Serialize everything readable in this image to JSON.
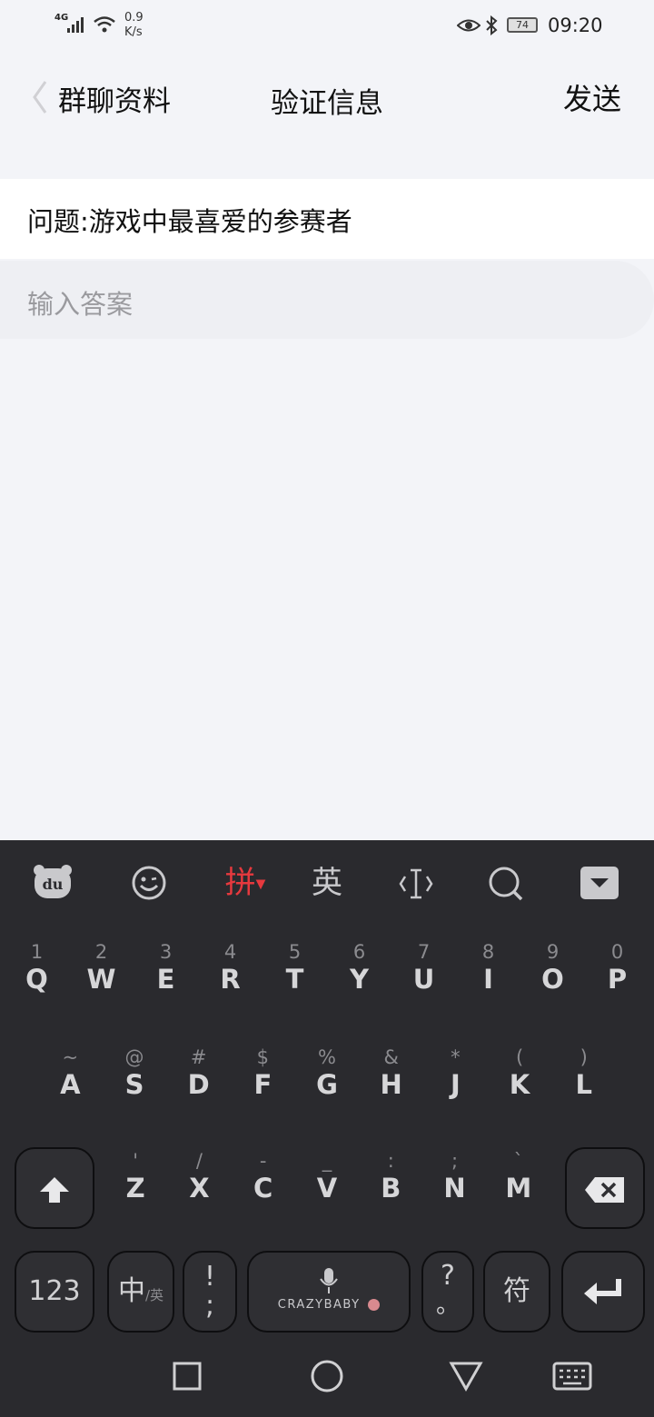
{
  "status_bar": {
    "network": "4G",
    "speed_value": "0.9",
    "speed_unit": "K/s",
    "battery": "74",
    "time": "09:20"
  },
  "header": {
    "back_label": "群聊资料",
    "title": "验证信息",
    "send": "发送"
  },
  "question": "问题:游戏中最喜爱的参赛者",
  "answer": {
    "placeholder": "输入答案"
  },
  "keyboard": {
    "toolbar": {
      "pinyin": "拼",
      "english": "英"
    },
    "row1": [
      {
        "sub": "1",
        "main": "Q"
      },
      {
        "sub": "2",
        "main": "W"
      },
      {
        "sub": "3",
        "main": "E"
      },
      {
        "sub": "4",
        "main": "R"
      },
      {
        "sub": "5",
        "main": "T"
      },
      {
        "sub": "6",
        "main": "Y"
      },
      {
        "sub": "7",
        "main": "U"
      },
      {
        "sub": "8",
        "main": "I"
      },
      {
        "sub": "9",
        "main": "O"
      },
      {
        "sub": "0",
        "main": "P"
      }
    ],
    "row2": [
      {
        "sub": "~",
        "main": "A"
      },
      {
        "sub": "@",
        "main": "S"
      },
      {
        "sub": "#",
        "main": "D"
      },
      {
        "sub": "$",
        "main": "F"
      },
      {
        "sub": "%",
        "main": "G"
      },
      {
        "sub": "&",
        "main": "H"
      },
      {
        "sub": "*",
        "main": "J"
      },
      {
        "sub": "(",
        "main": "K"
      },
      {
        "sub": ")",
        "main": "L"
      }
    ],
    "row3": [
      {
        "sub": "'",
        "main": "Z"
      },
      {
        "sub": "/",
        "main": "X"
      },
      {
        "sub": "-",
        "main": "C"
      },
      {
        "sub": "_",
        "main": "V"
      },
      {
        "sub": ":",
        "main": "B"
      },
      {
        "sub": ";",
        "main": "N"
      },
      {
        "sub": "`",
        "main": "M"
      }
    ],
    "bottom": {
      "num": "123",
      "zh": "中",
      "zh_sub": "/英",
      "punct_top": "!",
      "punct_bottom": ";",
      "space_brand": "CRAZYBABY",
      "q_top": "?",
      "q_bottom": "。",
      "symbols": "符"
    }
  },
  "colors": {
    "accent": "#e6393e",
    "background": "#f3f4f8",
    "keyboard": "#2a2a2e"
  }
}
